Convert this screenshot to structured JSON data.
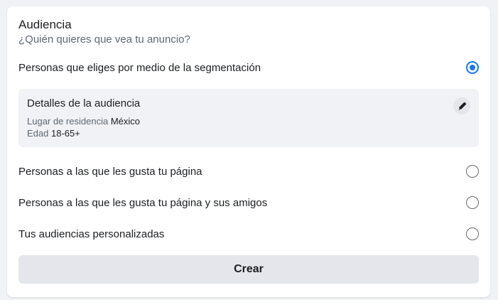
{
  "section": {
    "title": "Audiencia",
    "subtitle": "¿Quién quieres que vea tu anuncio?"
  },
  "options": [
    {
      "label": "Personas que eliges por medio de la segmentación",
      "selected": true
    },
    {
      "label": "Personas a las que les gusta tu página",
      "selected": false
    },
    {
      "label": "Personas a las que les gusta tu página y sus amigos",
      "selected": false
    },
    {
      "label": "Tus audiencias personalizadas",
      "selected": false
    }
  ],
  "details": {
    "title": "Detalles de la audiencia",
    "location_label": "Lugar de residencia",
    "location_value": "México",
    "age_label": "Edad",
    "age_value": "18-65+",
    "edit_icon": "pencil-icon"
  },
  "create_button": {
    "label": "Crear"
  },
  "colors": {
    "accent": "#1877f2",
    "panel_bg": "#f0f2f5",
    "button_bg": "#e4e6eb"
  }
}
